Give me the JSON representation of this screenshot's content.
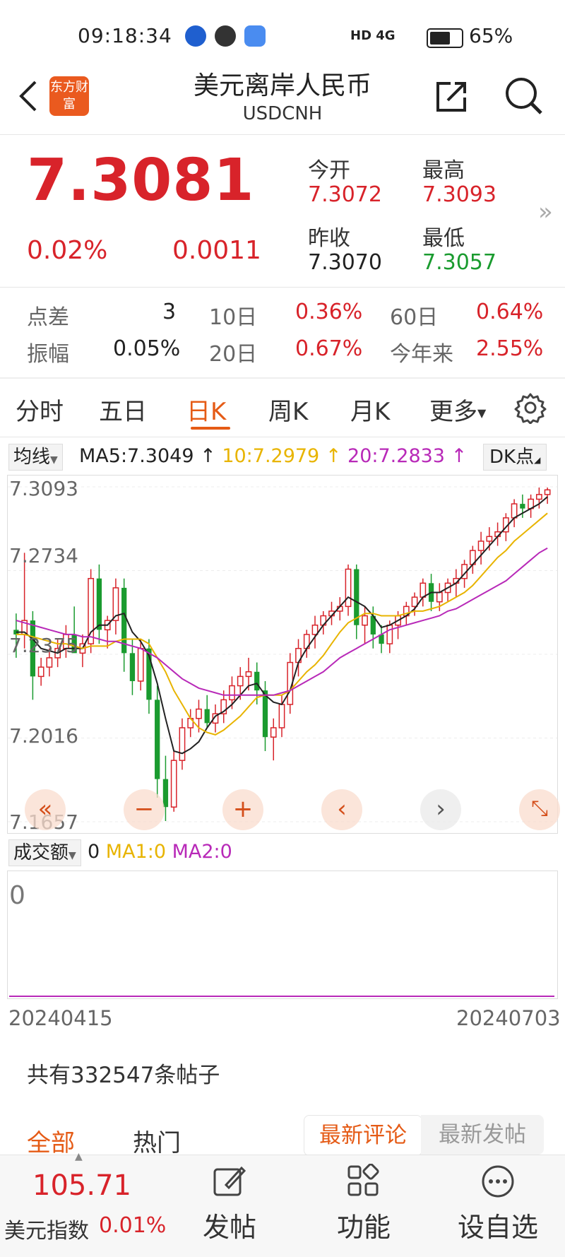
{
  "status": {
    "time": "09:18:34",
    "network": "HD 4G",
    "battery": "65%"
  },
  "header": {
    "app_logo_text": "东方财富",
    "title": "美元离岸人民币",
    "code": "USDCNH"
  },
  "quote": {
    "price": "7.3081",
    "change_pct": "0.02%",
    "change": "0.0011",
    "open_label": "今开",
    "open": "7.3072",
    "high_label": "最高",
    "high": "7.3093",
    "prev_label": "昨收",
    "prev_close": "7.3070",
    "low_label": "最低",
    "low": "7.3057"
  },
  "stats": {
    "spread_label": "点差",
    "spread": "3",
    "d10_label": "10日",
    "d10": "0.36%",
    "d60_label": "60日",
    "d60": "0.64%",
    "amp_label": "振幅",
    "amp": "0.05%",
    "d20_label": "20日",
    "d20": "0.67%",
    "ytd_label": "今年来",
    "ytd": "2.55%"
  },
  "tabs": [
    "分时",
    "五日",
    "日K",
    "周K",
    "月K",
    "更多"
  ],
  "active_tab": "日K",
  "chart_controls": {
    "ma_selector": "均线",
    "ma5": "MA5:7.3049",
    "ma10": "10:7.2979",
    "ma20": "20:7.2833",
    "dk_button": "DK点"
  },
  "colors": {
    "up": "#d8232a",
    "down": "#1a9b2f",
    "ma5": "#222222",
    "ma10": "#e8b400",
    "ma20": "#b829b8",
    "accent": "#e55b16"
  },
  "chart_data": {
    "type": "candlestick",
    "y_ticks": [
      "7.3093",
      "7.2734",
      "7.2375",
      "7.2016",
      "7.1657"
    ],
    "ylim": [
      7.1657,
      7.3093
    ],
    "x_range": [
      "20240415",
      "20240703"
    ],
    "ohlc": [
      [
        7.248,
        7.255,
        7.236,
        7.246
      ],
      [
        7.246,
        7.281,
        7.24,
        7.252
      ],
      [
        7.252,
        7.256,
        7.218,
        7.228
      ],
      [
        7.228,
        7.236,
        7.224,
        7.232
      ],
      [
        7.232,
        7.24,
        7.228,
        7.236
      ],
      [
        7.236,
        7.244,
        7.232,
        7.24
      ],
      [
        7.24,
        7.25,
        7.236,
        7.246
      ],
      [
        7.246,
        7.258,
        7.242,
        7.238
      ],
      [
        7.238,
        7.246,
        7.232,
        7.242
      ],
      [
        7.242,
        7.274,
        7.238,
        7.27
      ],
      [
        7.27,
        7.276,
        7.242,
        7.248
      ],
      [
        7.248,
        7.254,
        7.24,
        7.252
      ],
      [
        7.252,
        7.27,
        7.246,
        7.266
      ],
      [
        7.266,
        7.27,
        7.23,
        7.238
      ],
      [
        7.238,
        7.244,
        7.22,
        7.226
      ],
      [
        7.226,
        7.244,
        7.222,
        7.24
      ],
      [
        7.24,
        7.244,
        7.212,
        7.218
      ],
      [
        7.218,
        7.224,
        7.176,
        7.184
      ],
      [
        7.184,
        7.194,
        7.166,
        7.172
      ],
      [
        7.172,
        7.196,
        7.17,
        7.192
      ],
      [
        7.192,
        7.21,
        7.188,
        7.206
      ],
      [
        7.206,
        7.214,
        7.202,
        7.21
      ],
      [
        7.21,
        7.218,
        7.204,
        7.214
      ],
      [
        7.214,
        7.22,
        7.206,
        7.208
      ],
      [
        7.208,
        7.216,
        7.204,
        7.212
      ],
      [
        7.212,
        7.222,
        7.208,
        7.218
      ],
      [
        7.218,
        7.228,
        7.214,
        7.224
      ],
      [
        7.224,
        7.232,
        7.218,
        7.228
      ],
      [
        7.228,
        7.236,
        7.222,
        7.23
      ],
      [
        7.23,
        7.234,
        7.216,
        7.222
      ],
      [
        7.222,
        7.226,
        7.196,
        7.202
      ],
      [
        7.202,
        7.21,
        7.192,
        7.206
      ],
      [
        7.206,
        7.22,
        7.202,
        7.216
      ],
      [
        7.216,
        7.238,
        7.212,
        7.234
      ],
      [
        7.234,
        7.244,
        7.228,
        7.24
      ],
      [
        7.24,
        7.248,
        7.236,
        7.246
      ],
      [
        7.246,
        7.254,
        7.24,
        7.25
      ],
      [
        7.25,
        7.256,
        7.246,
        7.254
      ],
      [
        7.254,
        7.26,
        7.25,
        7.256
      ],
      [
        7.256,
        7.262,
        7.252,
        7.258
      ],
      [
        7.258,
        7.276,
        7.254,
        7.274
      ],
      [
        7.274,
        7.276,
        7.244,
        7.25
      ],
      [
        7.25,
        7.258,
        7.242,
        7.254
      ],
      [
        7.254,
        7.258,
        7.24,
        7.246
      ],
      [
        7.246,
        7.25,
        7.238,
        7.242
      ],
      [
        7.242,
        7.252,
        7.238,
        7.25
      ],
      [
        7.25,
        7.256,
        7.244,
        7.254
      ],
      [
        7.254,
        7.26,
        7.25,
        7.258
      ],
      [
        7.258,
        7.264,
        7.254,
        7.262
      ],
      [
        7.262,
        7.27,
        7.258,
        7.268
      ],
      [
        7.268,
        7.272,
        7.256,
        7.26
      ],
      [
        7.26,
        7.268,
        7.256,
        7.264
      ],
      [
        7.264,
        7.27,
        7.26,
        7.268
      ],
      [
        7.268,
        7.274,
        7.262,
        7.27
      ],
      [
        7.27,
        7.278,
        7.266,
        7.276
      ],
      [
        7.276,
        7.284,
        7.272,
        7.282
      ],
      [
        7.282,
        7.29,
        7.276,
        7.286
      ],
      [
        7.286,
        7.292,
        7.282,
        7.288
      ],
      [
        7.288,
        7.294,
        7.284,
        7.29
      ],
      [
        7.29,
        7.298,
        7.286,
        7.296
      ],
      [
        7.296,
        7.304,
        7.292,
        7.302
      ],
      [
        7.302,
        7.306,
        7.296,
        7.3
      ],
      [
        7.3,
        7.306,
        7.296,
        7.304
      ],
      [
        7.304,
        7.309,
        7.3,
        7.306
      ],
      [
        7.306,
        7.309,
        7.302,
        7.308
      ]
    ],
    "series": [
      {
        "name": "MA5",
        "values": [
          7.247,
          7.247,
          7.244,
          7.24,
          7.239,
          7.238,
          7.24,
          7.24,
          7.24,
          7.247,
          7.25,
          7.25,
          7.254,
          7.255,
          7.247,
          7.243,
          7.237,
          7.225,
          7.21,
          7.196,
          7.195,
          7.197,
          7.2,
          7.206,
          7.211,
          7.213,
          7.216,
          7.22,
          7.224,
          7.225,
          7.22,
          7.217,
          7.216,
          7.222,
          7.234,
          7.24,
          7.245,
          7.25,
          7.254,
          7.258,
          7.262,
          7.26,
          7.258,
          7.254,
          7.249,
          7.25,
          7.252,
          7.254,
          7.257,
          7.262,
          7.264,
          7.264,
          7.266,
          7.268,
          7.272,
          7.276,
          7.28,
          7.284,
          7.288,
          7.292,
          7.296,
          7.298,
          7.3,
          7.302,
          7.305
        ]
      },
      {
        "name": "MA10",
        "values": [
          7.246,
          7.246,
          7.245,
          7.244,
          7.243,
          7.242,
          7.242,
          7.241,
          7.24,
          7.241,
          7.241,
          7.241,
          7.243,
          7.244,
          7.244,
          7.244,
          7.242,
          7.236,
          7.23,
          7.222,
          7.216,
          7.21,
          7.206,
          7.204,
          7.203,
          7.205,
          7.208,
          7.211,
          7.215,
          7.219,
          7.22,
          7.22,
          7.22,
          7.222,
          7.226,
          7.23,
          7.233,
          7.237,
          7.242,
          7.247,
          7.251,
          7.253,
          7.255,
          7.255,
          7.254,
          7.254,
          7.254,
          7.255,
          7.256,
          7.256,
          7.257,
          7.258,
          7.26,
          7.262,
          7.264,
          7.267,
          7.271,
          7.275,
          7.279,
          7.282,
          7.286,
          7.289,
          7.292,
          7.295,
          7.298
        ]
      },
      {
        "name": "MA20",
        "values": [
          7.252,
          7.251,
          7.25,
          7.249,
          7.248,
          7.247,
          7.246,
          7.246,
          7.245,
          7.245,
          7.244,
          7.243,
          7.243,
          7.242,
          7.241,
          7.24,
          7.238,
          7.236,
          7.233,
          7.23,
          7.227,
          7.225,
          7.223,
          7.222,
          7.221,
          7.22,
          7.22,
          7.22,
          7.22,
          7.22,
          7.22,
          7.22,
          7.221,
          7.222,
          7.224,
          7.226,
          7.228,
          7.23,
          7.233,
          7.236,
          7.238,
          7.24,
          7.242,
          7.244,
          7.246,
          7.248,
          7.249,
          7.25,
          7.251,
          7.252,
          7.253,
          7.254,
          7.256,
          7.257,
          7.259,
          7.261,
          7.263,
          7.265,
          7.267,
          7.269,
          7.272,
          7.275,
          7.278,
          7.281,
          7.283
        ]
      }
    ]
  },
  "chart_nav": [
    "«",
    "−",
    "+",
    "‹",
    "›",
    "⤡"
  ],
  "volume": {
    "selector": "成交额",
    "value": "0",
    "ma1": "MA1:0",
    "ma2": "MA2:0",
    "axis_value": "0"
  },
  "dates": {
    "start": "20240415",
    "end": "20240703"
  },
  "posts": {
    "count_text": "共有332547条帖子"
  },
  "post_tabs": {
    "all": "全部",
    "hot": "热门",
    "latest_comment": "最新评论",
    "latest_post": "最新发帖"
  },
  "bottom": {
    "index_value": "105.71",
    "index_name": "美元指数",
    "index_change": "0.01%",
    "post": "发帖",
    "function": "功能",
    "watchlist": "设自选"
  }
}
